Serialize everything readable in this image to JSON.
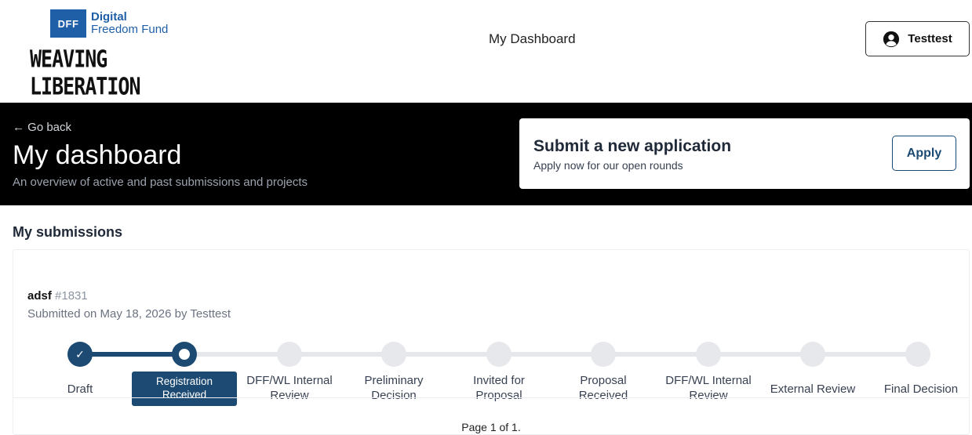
{
  "header": {
    "logo_box": "DFF",
    "logo_line1": "Digital",
    "logo_line2": "Freedom Fund",
    "logo_tagline": "WEAVING LIBERATION",
    "title": "My Dashboard",
    "user_name": "Testtest",
    "user_icon": "user-circle-icon"
  },
  "banner": {
    "go_back": "← Go back",
    "title": "My dashboard",
    "subtitle": "An overview of active and past submissions and projects",
    "apply_card": {
      "title": "Submit a new application",
      "subtitle": "Apply now for our open rounds",
      "button": "Apply"
    }
  },
  "submissions": {
    "section_title": "My submissions",
    "items": [
      {
        "name": "adsf",
        "id": "#1831",
        "meta": "Submitted on May 18, 2026 by Testtest",
        "steps": [
          {
            "label": "Draft",
            "state": "done"
          },
          {
            "label": "Registration Received",
            "state": "current"
          },
          {
            "label": "DFF/WL Internal Review",
            "state": "pending"
          },
          {
            "label": "Preliminary Decision",
            "state": "pending"
          },
          {
            "label": "Invited for Proposal",
            "state": "pending"
          },
          {
            "label": "Proposal Received",
            "state": "pending"
          },
          {
            "label": "DFF/WL Internal Review",
            "state": "pending"
          },
          {
            "label": "External Review",
            "state": "pending"
          },
          {
            "label": "Final Decision",
            "state": "pending"
          }
        ]
      }
    ],
    "pagination": "Page 1 of 1."
  },
  "colors": {
    "accent": "#1c4a73",
    "brand_blue": "#1f5fa8",
    "banner_bg": "#000000",
    "pending_node": "#e6e8eb"
  }
}
